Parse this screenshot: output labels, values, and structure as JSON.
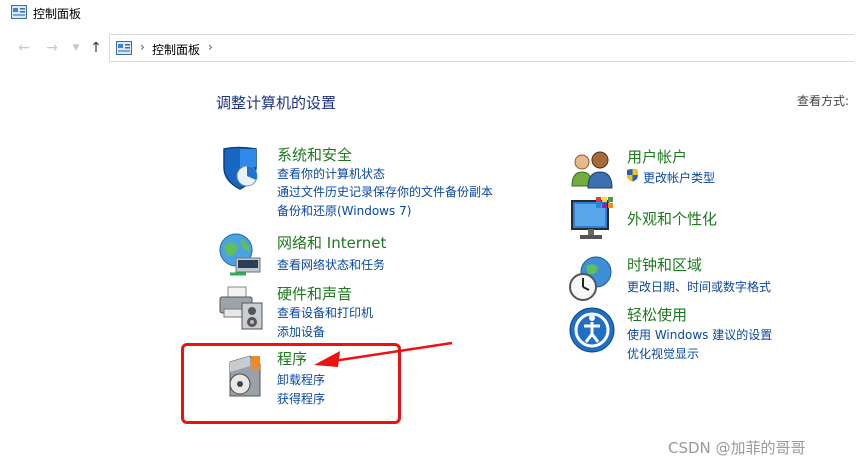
{
  "window": {
    "title": "控制面板"
  },
  "nav": {
    "back_icon": "back-arrow",
    "forward_icon": "forward-arrow",
    "recent_icon": "chevron-down",
    "up_icon": "up-arrow",
    "breadcrumb": "控制面板"
  },
  "main": {
    "heading": "调整计算机的设置",
    "view_by": "查看方式:"
  },
  "categories": {
    "system_security": {
      "title": "系统和安全",
      "links": [
        "查看你的计算机状态",
        "通过文件历史记录保存你的文件备份副本",
        "备份和还原(Windows 7)"
      ]
    },
    "network": {
      "title": "网络和 Internet",
      "links": [
        "查看网络状态和任务"
      ]
    },
    "hardware_sound": {
      "title": "硬件和声音",
      "links": [
        "查看设备和打印机",
        "添加设备"
      ]
    },
    "programs": {
      "title": "程序",
      "links": [
        "卸载程序",
        "获得程序"
      ]
    },
    "user_accounts": {
      "title": "用户帐户",
      "links": [
        "更改帐户类型"
      ]
    },
    "appearance": {
      "title": "外观和个性化"
    },
    "clock_region": {
      "title": "时钟和区域",
      "links": [
        "更改日期、时间或数字格式"
      ]
    },
    "ease_of_access": {
      "title": "轻松使用",
      "links": [
        "使用 Windows 建议的设置",
        "优化视觉显示"
      ]
    }
  },
  "annotation": {
    "color": "#ee1111"
  },
  "watermark": "CSDN @加菲的哥哥",
  "colors": {
    "heading": "#1e3287",
    "category_title": "#1e7a1e",
    "link": "#0a48a8"
  }
}
